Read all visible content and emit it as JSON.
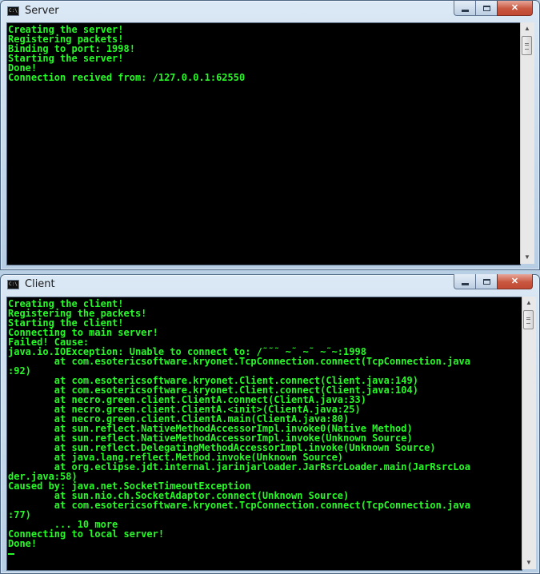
{
  "server_window": {
    "title": "Server",
    "icon": "console-app-icon",
    "console_lines": [
      "Creating the server!",
      "Registering packets!",
      "Binding to port: 1998!",
      "Starting the server!",
      "Done!",
      "Connection recived from: /127.0.0.1:62550"
    ]
  },
  "client_window": {
    "title": "Client",
    "icon": "console-app-icon",
    "console_lines": [
      "Creating the client!",
      "Registering the packets!",
      "Starting the client!",
      "Connecting to main server!",
      "Failed! Cause:",
      "java.io.IOException: Unable to connect to: /˜˜˜ ~˜ ~˜ ~˜~:1998",
      "        at com.esotericsoftware.kryonet.TcpConnection.connect(TcpConnection.java",
      ":92)",
      "        at com.esotericsoftware.kryonet.Client.connect(Client.java:149)",
      "        at com.esotericsoftware.kryonet.Client.connect(Client.java:104)",
      "        at necro.green.client.ClientA.connect(ClientA.java:33)",
      "        at necro.green.client.ClientA.<init>(ClientA.java:25)",
      "        at necro.green.client.ClientA.main(ClientA.java:80)",
      "        at sun.reflect.NativeMethodAccessorImpl.invoke0(Native Method)",
      "        at sun.reflect.NativeMethodAccessorImpl.invoke(Unknown Source)",
      "        at sun.reflect.DelegatingMethodAccessorImpl.invoke(Unknown Source)",
      "        at java.lang.reflect.Method.invoke(Unknown Source)",
      "        at org.eclipse.jdt.internal.jarinjarloader.JarRsrcLoader.main(JarRsrcLoa",
      "der.java:58)",
      "Caused by: java.net.SocketTimeoutException",
      "        at sun.nio.ch.SocketAdaptor.connect(Unknown Source)",
      "        at com.esotericsoftware.kryonet.TcpConnection.connect(TcpConnection.java",
      ":77)",
      "        ... 10 more",
      "Connecting to local server!",
      "Done!"
    ]
  },
  "colors": {
    "console_text": "#27f827",
    "console_background": "#000000",
    "close_button": "#c9563f"
  }
}
